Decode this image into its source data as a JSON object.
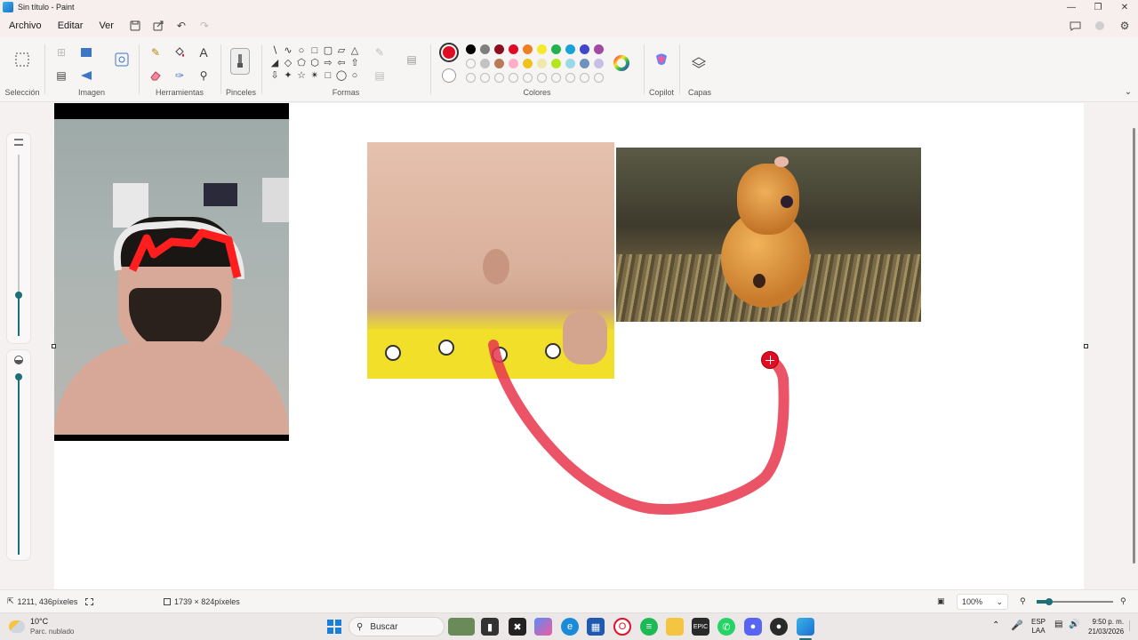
{
  "window": {
    "title": "Sin título - Paint"
  },
  "menu": {
    "items": [
      "Archivo",
      "Editar",
      "Ver"
    ]
  },
  "ribbon": {
    "groups": {
      "selection": "Selección",
      "image": "Imagen",
      "tools": "Herramientas",
      "brushes": "Pinceles",
      "shapes": "Formas",
      "colors": "Colores",
      "copilot": "Copilot",
      "layers": "Capas"
    },
    "primary_color": "#e00b24",
    "palette_row1": [
      "#000000",
      "#7f7f7f",
      "#8b0f1f",
      "#e00b24",
      "#f07f22",
      "#f5e92b",
      "#22b14c",
      "#15a3d8",
      "#3f48cc",
      "#a349a4"
    ],
    "palette_row2": [
      "",
      "#c3c3c3",
      "#b97a57",
      "#ffaec9",
      "#f0c21c",
      "#eee8aa",
      "#b5e61d",
      "#99d9ea",
      "#7092be",
      "#c8bfe7"
    ]
  },
  "status": {
    "cursor_position": "1211, 436píxeles",
    "canvas_size": "1739 × 824píxeles",
    "zoom": "100%"
  },
  "taskbar": {
    "weather_temp": "10°C",
    "weather_desc": "Parc. nublado",
    "search_placeholder": "Buscar",
    "language": "ESP",
    "language_sub": "LAA",
    "time": "9:50 p. m.",
    "date": "21/03/2026"
  },
  "icons": {
    "stroke_color": "#e8364c"
  }
}
